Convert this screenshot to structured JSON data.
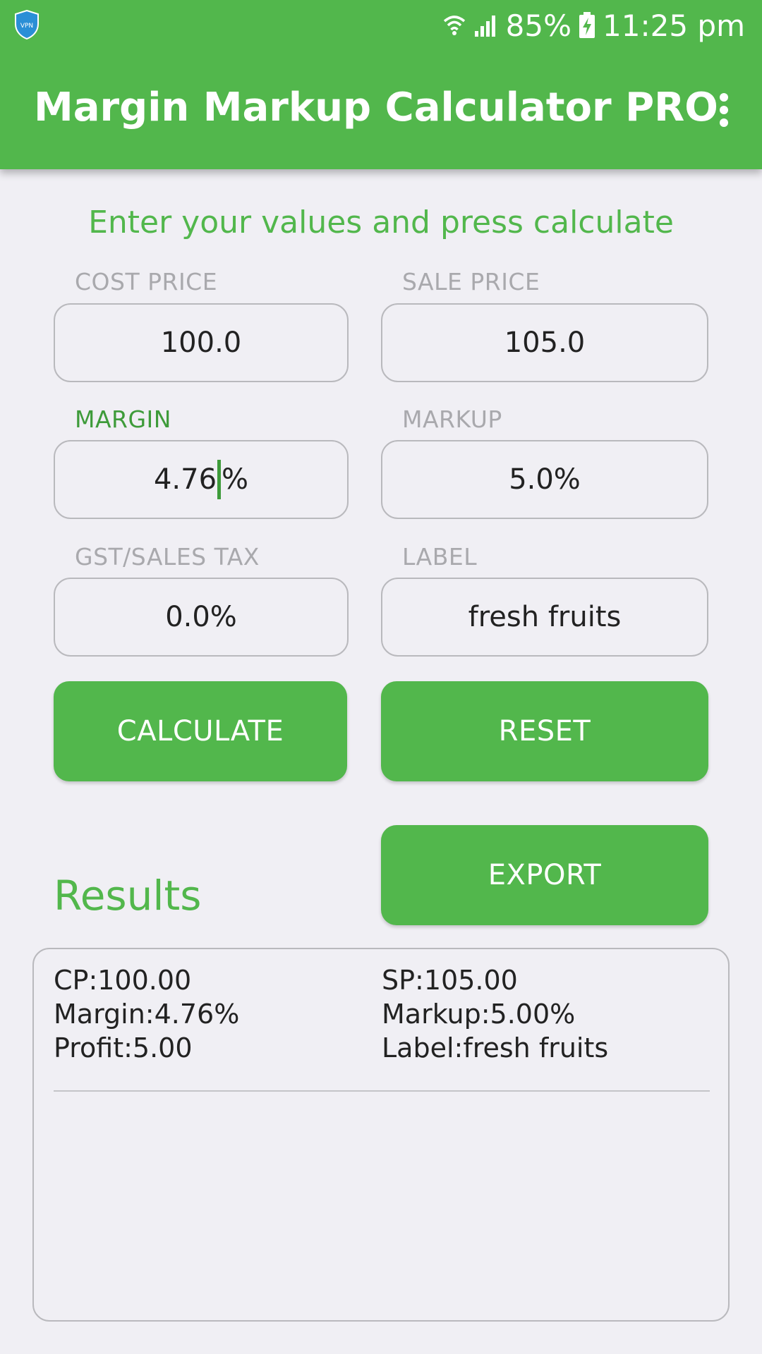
{
  "status_bar": {
    "battery": "85%",
    "time": "11:25 pm",
    "icons": [
      "vpn-shield-icon",
      "wifi-icon",
      "signal-icon",
      "battery-charging-icon"
    ],
    "vpn_text": "VPN"
  },
  "app_bar": {
    "title": "Margin Markup Calculator PRO",
    "menu_icon": "overflow-menu-icon",
    "color": "#52b74c"
  },
  "instruction": "Enter your values and press calculate",
  "fields": {
    "cost_price": {
      "label": "COST PRICE",
      "value": "100.0"
    },
    "sale_price": {
      "label": "SALE PRICE",
      "value": "105.0"
    },
    "margin": {
      "label": "MARGIN",
      "value_before_cursor": "4.76",
      "value_after_cursor": "%"
    },
    "markup": {
      "label": "MARKUP",
      "value": "5.0%"
    },
    "gst": {
      "label": "GST/SALES TAX",
      "value": "0.0%"
    },
    "label": {
      "label": "LABEL",
      "value": "fresh fruits"
    }
  },
  "buttons": {
    "calculate": "CALCULATE",
    "reset": "RESET",
    "export": "EXPORT"
  },
  "results": {
    "title": "Results",
    "cp": "CP:100.00",
    "sp": "SP:105.00",
    "margin": "Margin:4.76%",
    "markup": "Markup:5.00%",
    "profit": "Profit:5.00",
    "label": "Label:fresh fruits"
  },
  "colors": {
    "accent": "#52b74c",
    "accent_dark": "#3e9b3a",
    "background": "#f0eff4"
  }
}
